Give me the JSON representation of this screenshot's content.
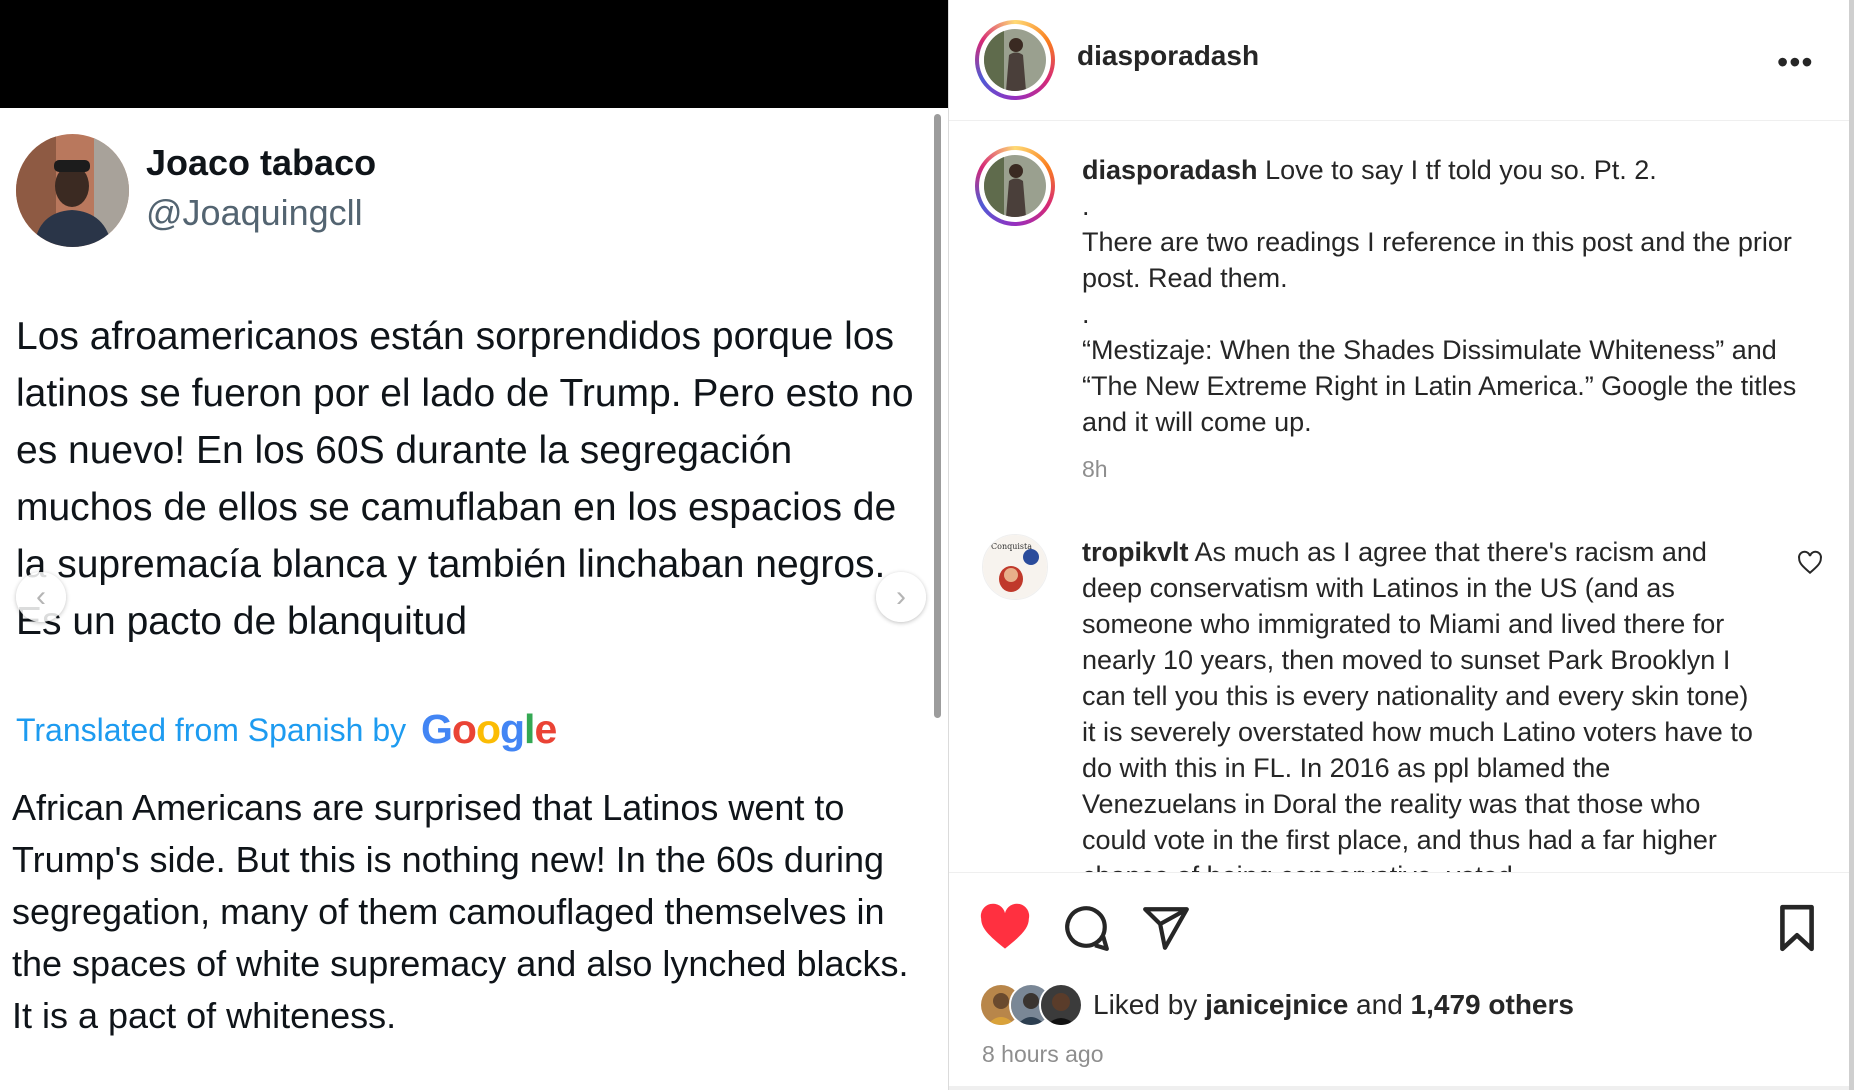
{
  "tweet": {
    "display_name": "Joaco tabaco",
    "handle": "@Joaquingcll",
    "original_text": "Los afroamericanos están sorprendidos porque los latinos se fueron por el lado de Trump. Pero esto no es nuevo! En los 60S durante la segregación muchos de ellos se camuflaban en los espacios de la supremacía blanca y también linchaban negros. Es un pacto de blanquitud",
    "translated_label": "Translated from Spanish by",
    "google_logo": "Google",
    "translation_text": "African Americans are surprised that Latinos went to Trump's side. But this is nothing new! In the 60s during segregation, many of them camouflaged themselves in the spaces of white supremacy and also lynched blacks. It is a pact of whiteness.",
    "nav_prev_icon": "chevron-left-icon",
    "nav_next_icon": "chevron-right-icon"
  },
  "instagram": {
    "header": {
      "username": "diasporadash",
      "more_icon": "more-horizontal-icon"
    },
    "caption": {
      "username": "diasporadash",
      "lines": [
        "Love to say I tf told you so. Pt. 2.",
        ".",
        "There are two readings I reference in this post and the prior post. Read them.",
        ".",
        "“Mestizaje: When the Shades Dissimulate Whiteness” and “The New Extreme Right in Latin America.” Google the titles and it will come up."
      ],
      "time": "8h"
    },
    "comment": {
      "username": "tropikvlt",
      "text": "As much as I agree that there's racism and deep conservatism with Latinos in the US (and as someone who immigrated to Miami and lived there for nearly 10 years, then moved to sunset Park Brooklyn I can tell you this is every nationality and every skin tone) it is severely overstated how much Latino voters have to do with this in FL. In 2016 as ppl blamed the Venezuelans in Doral the reality was that those who could vote in the first place, and thus had a far higher chance of being conservative, voted"
    },
    "likes": {
      "prefix": "Liked by",
      "user": "janicejnice",
      "connector": "and",
      "others": "1,479 others"
    },
    "time_ago": "8 hours ago",
    "colors": {
      "like_red": "#ff3040",
      "link_blue": "#1d9bf0"
    }
  }
}
